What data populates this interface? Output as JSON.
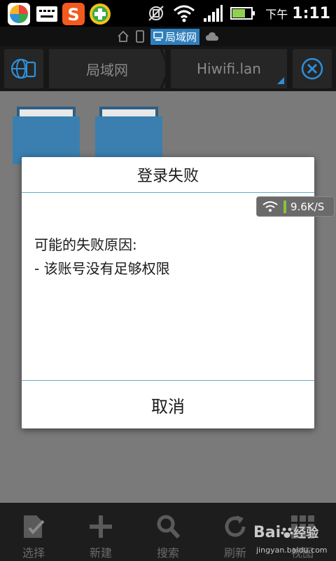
{
  "status_bar": {
    "time_prefix": "下午",
    "time": "1:11"
  },
  "path_strip": {
    "current_label": "局域网"
  },
  "toolbar": {
    "crumb_lan": "局域网",
    "crumb_host": "Hiwifi.lan"
  },
  "dialog": {
    "title": "登录失败",
    "reason_heading": "可能的失败原因:",
    "reason_line": "- 该账号没有足够权限",
    "cancel_label": "取消"
  },
  "speed_badge": {
    "speed": "9.6K/S"
  },
  "bottom_bar": {
    "items": [
      {
        "label": "选择",
        "icon": "select-icon"
      },
      {
        "label": "新建",
        "icon": "plus-icon"
      },
      {
        "label": "搜索",
        "icon": "search-icon"
      },
      {
        "label": "刷新",
        "icon": "refresh-icon"
      },
      {
        "label": "视图",
        "icon": "grid-icon"
      }
    ]
  },
  "watermark": {
    "brand": "Bai",
    "brand_cn": "经验",
    "url": "jingyan.baidu.com"
  },
  "colors": {
    "accent": "#2f7fbd",
    "folder": "#3a7fb0",
    "dialog_divider": "#5fb0c8"
  }
}
